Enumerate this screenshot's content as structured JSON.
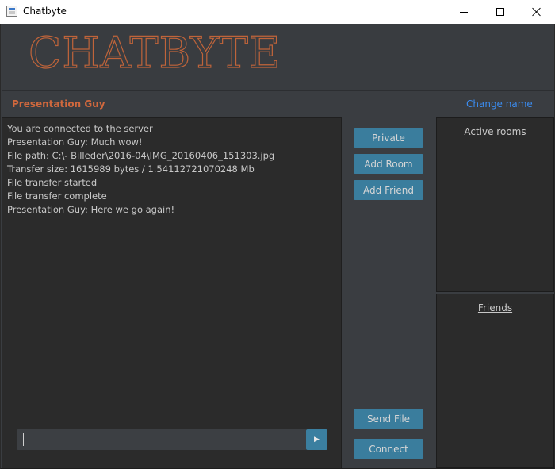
{
  "window": {
    "title": "Chatbyte",
    "icon": "app-window-icon"
  },
  "header": {
    "logo_text": "CHATBYTE"
  },
  "userbar": {
    "username": "Presentation Guy",
    "change_name_label": "Change name"
  },
  "chat": {
    "messages": [
      "You are connected to the server",
      "Presentation Guy: Much wow!",
      "File path: C:\\- Billeder\\2016-04\\IMG_20160406_151303.jpg",
      "Transfer size: 1615989 bytes / 1.54112721070248 Mb",
      "File transfer started",
      "File transfer complete",
      "Presentation Guy: Here we go again!"
    ],
    "input_value": "",
    "send_icon": "play-arrow-icon"
  },
  "actions": {
    "private_label": "Private",
    "add_room_label": "Add Room",
    "add_friend_label": "Add Friend",
    "send_file_label": "Send File",
    "connect_label": "Connect"
  },
  "sidebar": {
    "active_rooms_title": "Active rooms",
    "friends_title": "Friends"
  },
  "colors": {
    "accent_button": "#3a7d9d",
    "logo": "#c0643a",
    "username": "#d0683d",
    "link": "#3b8cf0",
    "background": "#3a3d41",
    "panel": "#2b2b2b"
  }
}
